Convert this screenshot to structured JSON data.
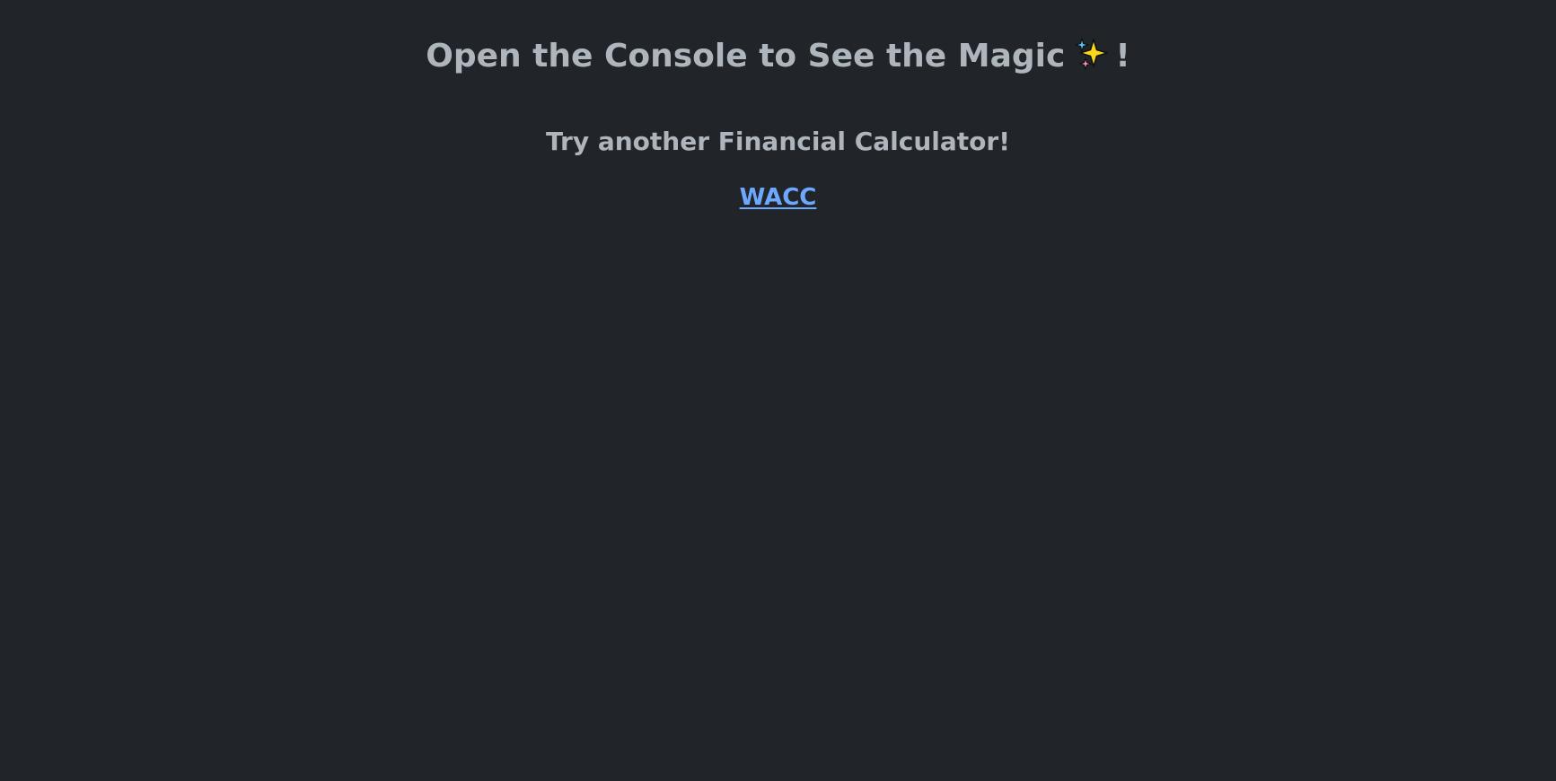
{
  "headline": {
    "text": "Open the Console to See the Magic",
    "icon": "sparkles-icon",
    "suffix": "!"
  },
  "subheading": "Try another Financial Calculator!",
  "links": [
    {
      "label": "WACC"
    }
  ],
  "colors": {
    "background": "#212428",
    "text": "#aeb5bd",
    "link": "#6ea8fe"
  }
}
